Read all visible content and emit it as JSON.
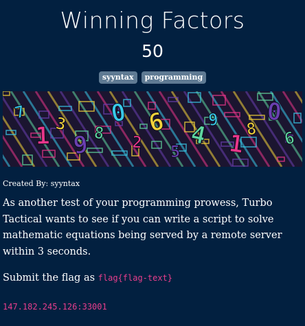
{
  "challenge": {
    "title": "Winning Factors",
    "points": "50",
    "tags": [
      "syyntax",
      "programming"
    ],
    "author_text": "Created By: syyntax",
    "description": "As another test of your programming prowess, Turbo Tactical wants to see if you can write a script to solve mathematic equations being served by a remote server within 3 seconds.",
    "submit_prefix": "Submit the flag as",
    "flag_format": "flag{flag-text}",
    "connection": "147.182.245.126:33001"
  },
  "banner": {
    "icon": "numbers-artwork-image",
    "glyphs": [
      "7",
      "1",
      "3",
      "9",
      "8",
      "0",
      "2",
      "6",
      "5",
      "4",
      "9",
      "1",
      "8",
      "0",
      "6"
    ],
    "colors": {
      "background": "#1b1530",
      "cyan": "#38c8e8",
      "magenta": "#e8368a",
      "yellow": "#f2d23a",
      "purple": "#6a3fb0",
      "green": "#5fd7a0"
    }
  },
  "theme": {
    "page_background": "#022040",
    "tag_background": "#5f7a93",
    "code_color": "#e83e8c"
  }
}
